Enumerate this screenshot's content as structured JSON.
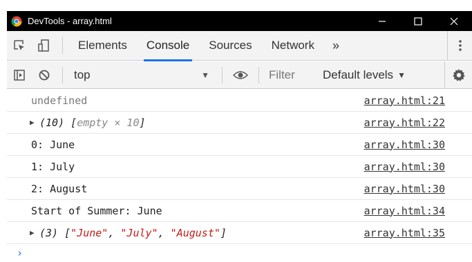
{
  "window": {
    "title": "DevTools - array.html"
  },
  "tabs": {
    "items": [
      "Elements",
      "Console",
      "Sources",
      "Network"
    ],
    "active": "Console",
    "more": "»"
  },
  "console_toolbar": {
    "context": "top",
    "filter_placeholder": "Filter",
    "levels": "Default levels"
  },
  "messages": [
    {
      "text": "undefined",
      "source": "array.html:21"
    },
    {
      "count": "(10)",
      "open": "[",
      "body": "empty × 10",
      "close": "]",
      "source": "array.html:22"
    },
    {
      "text": "0: June",
      "source": "array.html:30"
    },
    {
      "text": "1: July",
      "source": "array.html:30"
    },
    {
      "text": "2: August",
      "source": "array.html:30"
    },
    {
      "text": "Start of Summer: June",
      "source": "array.html:34"
    },
    {
      "count": "(3)",
      "open": "[",
      "items": [
        "\"June\"",
        "\"July\"",
        "\"August\""
      ],
      "sep": ", ",
      "close": "]",
      "source": "array.html:35"
    }
  ],
  "prompt": "›",
  "colors": {
    "accent": "#1a73e8",
    "string": "#c41a16",
    "titlebar": "#000000"
  }
}
